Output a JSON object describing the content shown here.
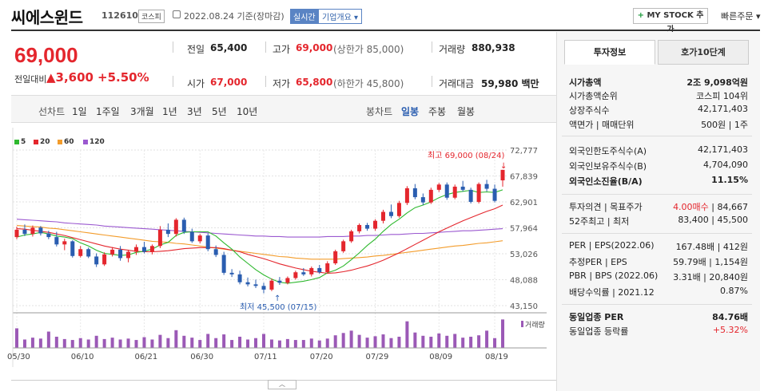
{
  "header": {
    "title": "씨에스윈드",
    "code": "112610",
    "market": "코스피",
    "date": "2022.08.24 기준(장마감)",
    "realtime": "실시간",
    "company_info": "기업개요",
    "mystock_label": "MY STOCK 추가",
    "quick_order": "빠른주문"
  },
  "price": {
    "current": "69,000",
    "diff_label": "전일대비",
    "diff": "▲3,600",
    "diff_pct": "+5.50%",
    "stats": {
      "prev_label": "전일",
      "prev": "65,400",
      "high_label": "고가",
      "high": "69,000",
      "upper_limit": "(상한가 85,000)",
      "volume_label": "거래량",
      "volume": "880,938",
      "open_label": "시가",
      "open": "67,000",
      "low_label": "저가",
      "low": "65,800",
      "lower_limit": "(하한가 45,800)",
      "amount_label": "거래대금",
      "amount": "59,980 백만"
    }
  },
  "periods": {
    "line_label": "선차트",
    "line": [
      "1일",
      "1주일",
      "3개월",
      "1년",
      "3년",
      "5년",
      "10년"
    ],
    "candle_label": "봉차트",
    "candle": [
      "일봉",
      "주봉",
      "월봉"
    ]
  },
  "legend": [
    {
      "label": "5",
      "color": "#2eb82e"
    },
    {
      "label": "20",
      "color": "#e4262d"
    },
    {
      "label": "60",
      "color": "#f39c2b"
    },
    {
      "label": "120",
      "color": "#9b59d0"
    }
  ],
  "chart_data": {
    "type": "candlestick",
    "y_ticks": [
      "72,777",
      "67,839",
      "62,901",
      "57,964",
      "53,026",
      "48,088",
      "43,150"
    ],
    "ylim": [
      43150,
      72777
    ],
    "x_ticks": [
      "05/30",
      "06/10",
      "06/21",
      "06/30",
      "07/11",
      "07/20",
      "07/29",
      "08/09",
      "08/19"
    ],
    "high_annotation": "최고 69,000 (08/24)",
    "low_annotation": "최저 45,500 (07/15)",
    "volume_label": "거래량",
    "candles": [
      [
        56200,
        58200,
        55800,
        57600
      ],
      [
        57600,
        58600,
        56400,
        56800
      ],
      [
        56800,
        58400,
        56300,
        58000
      ],
      [
        58000,
        58300,
        56500,
        56900
      ],
      [
        56900,
        57400,
        55800,
        56200
      ],
      [
        56200,
        57200,
        54400,
        54800
      ],
      [
        54800,
        55900,
        53700,
        55400
      ],
      [
        55400,
        55600,
        52300,
        52600
      ],
      [
        52600,
        54500,
        52300,
        53900
      ],
      [
        53900,
        54200,
        52200,
        52500
      ],
      [
        52500,
        53100,
        50500,
        51000
      ],
      [
        51000,
        53300,
        50700,
        52900
      ],
      [
        52900,
        54300,
        52500,
        53800
      ],
      [
        53800,
        54500,
        51700,
        52200
      ],
      [
        52200,
        53800,
        51400,
        53400
      ],
      [
        53400,
        54800,
        52800,
        54300
      ],
      [
        54300,
        55300,
        53100,
        53400
      ],
      [
        53400,
        54800,
        52900,
        54500
      ],
      [
        54500,
        58300,
        54100,
        57600
      ],
      [
        57600,
        58800,
        56200,
        56800
      ],
      [
        56800,
        59800,
        56300,
        59500
      ],
      [
        59500,
        59900,
        56800,
        57200
      ],
      [
        57200,
        57800,
        55100,
        55400
      ],
      [
        55400,
        56800,
        55000,
        56500
      ],
      [
        56500,
        56900,
        53500,
        53900
      ],
      [
        53900,
        54600,
        52400,
        52800
      ],
      [
        52800,
        53400,
        49000,
        49400
      ],
      [
        49400,
        50100,
        48600,
        49100
      ],
      [
        49100,
        49800,
        47200,
        47600
      ],
      [
        47600,
        48500,
        46800,
        47200
      ],
      [
        47200,
        48100,
        46500,
        46900
      ],
      [
        46900,
        47500,
        45500,
        46200
      ],
      [
        46200,
        48300,
        45900,
        47900
      ],
      [
        47900,
        48600,
        47100,
        47500
      ],
      [
        47500,
        48700,
        47200,
        48400
      ],
      [
        48400,
        49800,
        48100,
        49500
      ],
      [
        49500,
        50300,
        48800,
        49100
      ],
      [
        49100,
        50600,
        48700,
        50300
      ],
      [
        50300,
        50900,
        49200,
        49500
      ],
      [
        49500,
        51600,
        49200,
        51200
      ],
      [
        51200,
        53800,
        50900,
        53500
      ],
      [
        53500,
        55700,
        53200,
        55400
      ],
      [
        55400,
        57600,
        55100,
        57300
      ],
      [
        57300,
        58800,
        56900,
        58500
      ],
      [
        58500,
        58900,
        57400,
        57800
      ],
      [
        57800,
        59600,
        57400,
        59300
      ],
      [
        59300,
        61400,
        58800,
        61000
      ],
      [
        61000,
        62400,
        59800,
        60200
      ],
      [
        60200,
        63100,
        59900,
        62700
      ],
      [
        62700,
        65900,
        62300,
        65500
      ],
      [
        65500,
        66300,
        63400,
        63800
      ],
      [
        63800,
        64500,
        62300,
        62800
      ],
      [
        62800,
        65600,
        62500,
        65200
      ],
      [
        65200,
        66500,
        64800,
        66200
      ],
      [
        66200,
        66600,
        63300,
        63700
      ],
      [
        63700,
        66200,
        63400,
        65800
      ],
      [
        65800,
        66900,
        64900,
        65200
      ],
      [
        65200,
        65600,
        62600,
        62900
      ],
      [
        62900,
        66600,
        62600,
        66300
      ],
      [
        66300,
        67100,
        64900,
        65400
      ],
      [
        65400,
        66200,
        62800,
        63100
      ],
      [
        67000,
        69000,
        65800,
        69000
      ]
    ],
    "volumes": [
      42,
      18,
      22,
      20,
      35,
      24,
      19,
      17,
      21,
      18,
      26,
      19,
      22,
      18,
      20,
      17,
      23,
      18,
      28,
      21,
      38,
      26,
      22,
      17,
      30,
      21,
      29,
      17,
      24,
      18,
      21,
      30,
      18,
      16,
      19,
      17,
      17,
      20,
      16,
      20,
      27,
      32,
      37,
      28,
      22,
      25,
      29,
      21,
      24,
      57,
      33,
      26,
      24,
      31,
      26,
      30,
      22,
      24,
      27,
      37,
      21,
      61
    ],
    "ma": {
      "5": [
        56200,
        56600,
        56800,
        57100,
        56800,
        56400,
        56200,
        55900,
        55100,
        54500,
        53700,
        53100,
        52900,
        52700,
        52800,
        53300,
        53500,
        53900,
        54700,
        55200,
        56500,
        57100,
        57200,
        57200,
        57200,
        56400,
        55100,
        53900,
        52400,
        51200,
        50000,
        49000,
        48200,
        47600,
        47400,
        47600,
        47800,
        48100,
        48500,
        49400,
        49900,
        50700,
        51900,
        53200,
        54600,
        55800,
        57300,
        58600,
        59600,
        60800,
        61800,
        62300,
        62900,
        63700,
        64300,
        64700,
        64900,
        65100,
        64700,
        64800,
        64700,
        65200
      ],
      "20": [
        57800,
        57700,
        57500,
        57300,
        57100,
        56800,
        56500,
        56100,
        55700,
        55300,
        54900,
        54500,
        54200,
        53900,
        53700,
        53500,
        53400,
        53400,
        53500,
        53600,
        53800,
        54000,
        54100,
        54200,
        54200,
        54200,
        54000,
        53700,
        53400,
        52900,
        52500,
        52100,
        51600,
        51100,
        50700,
        50300,
        50000,
        49700,
        49500,
        49300,
        49400,
        49600,
        49900,
        50300,
        50700,
        51200,
        51800,
        52500,
        53200,
        54000,
        54800,
        55600,
        56400,
        57200,
        57900,
        58600,
        59300,
        59900,
        60500,
        61100,
        61600,
        62300
      ],
      "60": [
        58400,
        58300,
        58200,
        58100,
        57900,
        57800,
        57600,
        57400,
        57200,
        57000,
        56800,
        56600,
        56400,
        56200,
        56000,
        55800,
        55600,
        55400,
        55300,
        55200,
        55000,
        54900,
        54700,
        54500,
        54300,
        54100,
        53900,
        53700,
        53500,
        53300,
        53100,
        52900,
        52700,
        52500,
        52400,
        52200,
        52100,
        52000,
        52000,
        52000,
        52000,
        52100,
        52200,
        52300,
        52400,
        52600,
        52700,
        52900,
        53100,
        53300,
        53500,
        53700,
        53900,
        54100,
        54300,
        54500,
        54600,
        54800,
        55000,
        55100,
        55300,
        55500
      ],
      "120": [
        59600,
        59500,
        59400,
        59300,
        59200,
        59100,
        58900,
        58800,
        58700,
        58600,
        58500,
        58300,
        58200,
        58100,
        58000,
        57900,
        57800,
        57700,
        57600,
        57500,
        57400,
        57300,
        57200,
        57100,
        57000,
        56900,
        56800,
        56700,
        56600,
        56500,
        56400,
        56400,
        56300,
        56300,
        56200,
        56200,
        56200,
        56200,
        56200,
        56300,
        56300,
        56300,
        56400,
        56400,
        56500,
        56500,
        56600,
        56700,
        56700,
        56800,
        56900,
        56900,
        57000,
        57100,
        57200,
        57300,
        57400,
        57400,
        57500,
        57600,
        57700,
        57800
      ]
    }
  },
  "right_panel": {
    "tabs": [
      "투자정보",
      "호가10단계"
    ],
    "market_cap_label": "시가총액",
    "market_cap": "2조 9,098억원",
    "market_cap_rank_label": "시가총액순위",
    "market_cap_rank": "코스피 104위",
    "shares_label": "상장주식수",
    "shares": "42,171,403",
    "par_label": "액면가 | 매매단위",
    "par": "500원 | 1주",
    "foreign_limit_label": "외국인한도주식수(A)",
    "foreign_limit": "42,171,403",
    "foreign_hold_label": "외국인보유주식수(B)",
    "foreign_hold": "4,704,090",
    "foreign_ratio_label": "외국인소진율(B/A)",
    "foreign_ratio": "11.15%",
    "opinion_label": "투자의견 | 목표주가",
    "opinion": "4.00매수",
    "target": "84,667",
    "week52_label": "52주최고 | 최저",
    "week52": "83,400 | 45,500",
    "per_label": "PER | EPS(2022.06)",
    "per": "167.48배 | 412원",
    "est_per_label": "추정PER | EPS",
    "est_per": "59.79배 | 1,154원",
    "pbr_label": "PBR | BPS (2022.06)",
    "pbr": "3.31배 | 20,840원",
    "dividend_label": "배당수익률 | 2021.12",
    "dividend": "0.87%",
    "sector_per_label": "동일업종 PER",
    "sector_per": "84.76배",
    "sector_rate_label": "동일업종 등락률",
    "sector_rate": "+5.32%"
  },
  "colors": {
    "up": "#e4262d",
    "down": "#2a5db0",
    "volume": "#9b59b6"
  }
}
